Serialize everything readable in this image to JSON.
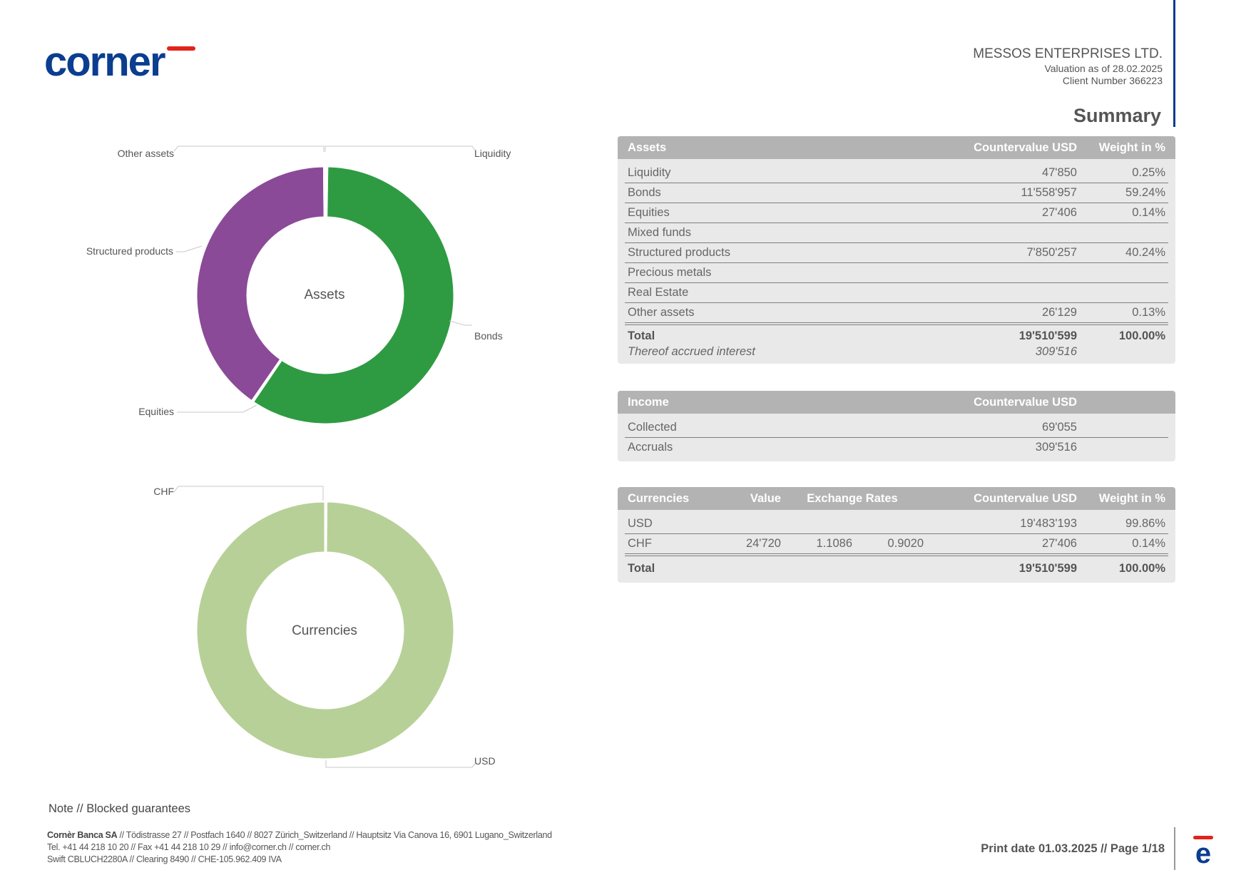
{
  "brand": {
    "logo_text": "cornèr",
    "primary_color": "#0b3d91",
    "accent_color": "#e2231a"
  },
  "client": {
    "name": "MESSOS ENTERPRISES LTD.",
    "valuation": "Valuation as of 28.02.2025",
    "client_number": "Client Number 366223"
  },
  "page_title": "Summary",
  "chart_data": [
    {
      "type": "donut",
      "center_label": "Assets",
      "labels": [
        "Liquidity",
        "Bonds",
        "Equities",
        "Structured products",
        "Other assets"
      ],
      "values": [
        0.25,
        59.24,
        0.14,
        40.24,
        0.13
      ],
      "colors": [
        "#2e9b42",
        "#2e9b42",
        "#2e9b42",
        "#8b4a98",
        "#8b4a98"
      ]
    },
    {
      "type": "donut",
      "center_label": "Currencies",
      "labels": [
        "CHF",
        "USD"
      ],
      "values": [
        0.14,
        99.86
      ],
      "colors": [
        "#b7d097",
        "#b7d097"
      ]
    }
  ],
  "assets_table": {
    "headers": {
      "label": "Assets",
      "countervalue": "Countervalue USD",
      "weight": "Weight in %"
    },
    "rows": [
      {
        "label": "Liquidity",
        "countervalue": "47'850",
        "weight": "0.25%"
      },
      {
        "label": "Bonds",
        "countervalue": "11'558'957",
        "weight": "59.24%"
      },
      {
        "label": "Equities",
        "countervalue": "27'406",
        "weight": "0.14%"
      },
      {
        "label": "Mixed funds",
        "countervalue": "",
        "weight": ""
      },
      {
        "label": "Structured products",
        "countervalue": "7'850'257",
        "weight": "40.24%"
      },
      {
        "label": "Precious metals",
        "countervalue": "",
        "weight": ""
      },
      {
        "label": "Real Estate",
        "countervalue": "",
        "weight": ""
      },
      {
        "label": "Other assets",
        "countervalue": "26'129",
        "weight": "0.13%"
      }
    ],
    "total": {
      "label": "Total",
      "countervalue": "19'510'599",
      "weight": "100.00%"
    },
    "accrued": {
      "label": "Thereof accrued interest",
      "countervalue": "309'516"
    }
  },
  "income_table": {
    "headers": {
      "label": "Income",
      "countervalue": "Countervalue USD"
    },
    "rows": [
      {
        "label": "Collected",
        "countervalue": "69'055"
      },
      {
        "label": "Accruals",
        "countervalue": "309'516"
      }
    ]
  },
  "currencies_table": {
    "headers": {
      "label": "Currencies",
      "value": "Value",
      "rates": "Exchange Rates",
      "countervalue": "Countervalue USD",
      "weight": "Weight in %"
    },
    "rows": [
      {
        "label": "USD",
        "value": "",
        "rate1": "",
        "rate2": "",
        "countervalue": "19'483'193",
        "weight": "99.86%"
      },
      {
        "label": "CHF",
        "value": "24'720",
        "rate1": "1.1086",
        "rate2": "0.9020",
        "countervalue": "27'406",
        "weight": "0.14%"
      }
    ],
    "total": {
      "label": "Total",
      "countervalue": "19'510'599",
      "weight": "100.00%"
    }
  },
  "note": "Note // Blocked guarantees",
  "footer": {
    "bank": "Cornèr Banca SA",
    "line1": " // Tödistrasse 27 // Postfach 1640 // 8027 Zürich_Switzerland // Hauptsitz Via Canova 16, 6901 Lugano_Switzerland",
    "line2": "Tel. +41 44 218 10 20 // Fax +41 44 218 10 29 // info@corner.ch // corner.ch",
    "line3": "Swift CBLUCH2280A // Clearing 8490 // CHE-105.962.409 IVA"
  },
  "print_info": "Print date 01.03.2025 // Page 1/18"
}
